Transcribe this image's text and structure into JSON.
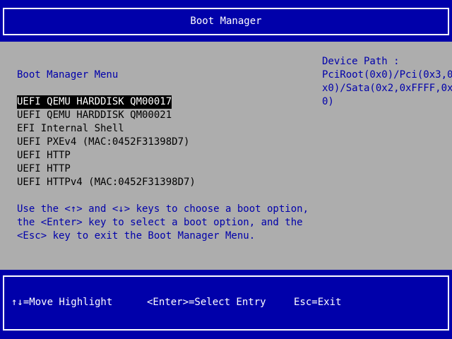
{
  "header": {
    "title": "Boot Manager"
  },
  "menu": {
    "heading": "Boot Manager Menu",
    "options": [
      {
        "label": "UEFI QEMU HARDDISK QM00017",
        "selected": true
      },
      {
        "label": "UEFI QEMU HARDDISK QM00021",
        "selected": false
      },
      {
        "label": "EFI Internal Shell",
        "selected": false
      },
      {
        "label": "UEFI PXEv4 (MAC:0452F31398D7)",
        "selected": false
      },
      {
        "label": "UEFI HTTP",
        "selected": false
      },
      {
        "label": "UEFI HTTP",
        "selected": false
      },
      {
        "label": "UEFI HTTPv4 (MAC:0452F31398D7)",
        "selected": false
      }
    ],
    "help_lines": [
      "Use the <↑> and <↓> keys to choose a boot option,",
      "the <Enter> key to select a boot option, and the",
      "<Esc> key to exit the Boot Manager Menu."
    ]
  },
  "device_path": {
    "label": "Device Path :",
    "lines": [
      "PciRoot(0x0)/Pci(0x3,0",
      "x0)/Sata(0x2,0xFFFF,0x",
      "0)"
    ]
  },
  "footer": {
    "move_hint": "↑↓=Move Highlight",
    "enter_hint": "<Enter>=Select Entry",
    "esc_hint": "Esc=Exit"
  },
  "colors": {
    "background": "#adadad",
    "band": "#0000aa",
    "text_blue": "#0000aa",
    "text_black": "#000000",
    "highlight_bg": "#000000",
    "highlight_fg": "#ffffff"
  }
}
